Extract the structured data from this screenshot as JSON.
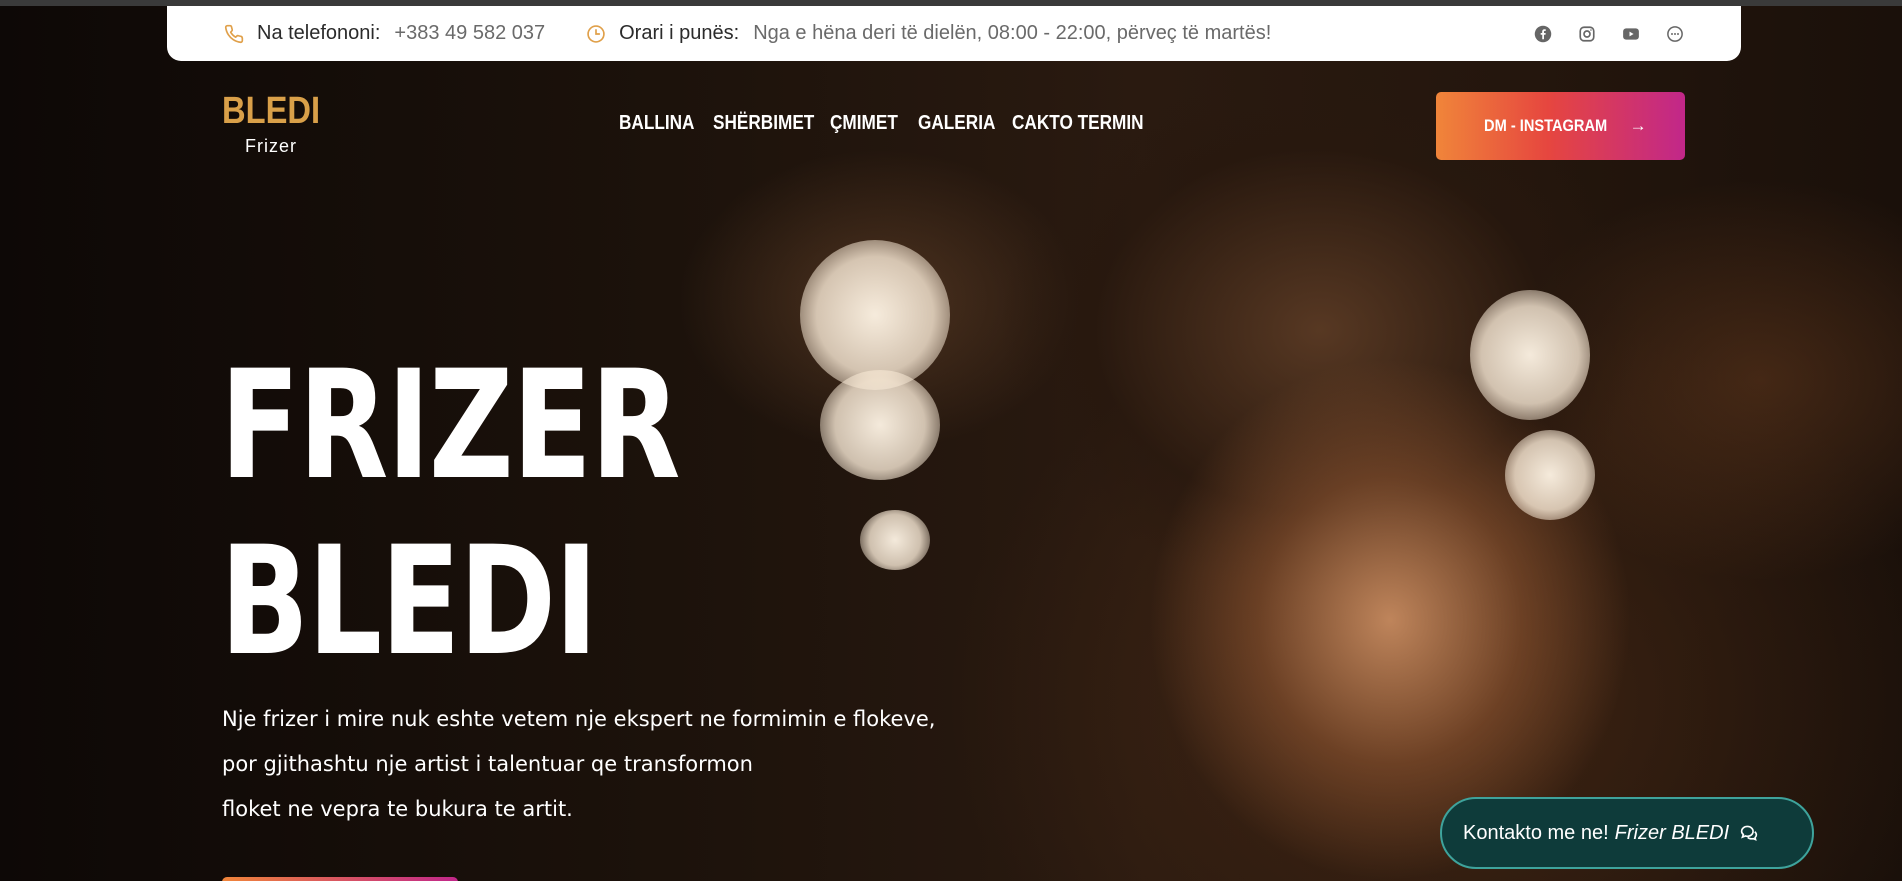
{
  "topbar": {
    "phone_label": "Na telefononi:",
    "phone_value": "+383 49 582 037",
    "hours_label": "Orari i punës:",
    "hours_value": "Nga e hëna deri të dielën, 08:00 - 22:00, përveç të martës!",
    "socials": [
      {
        "icon": "facebook-icon"
      },
      {
        "icon": "instagram-icon"
      },
      {
        "icon": "youtube-icon"
      },
      {
        "icon": "chat-icon"
      }
    ]
  },
  "logo": {
    "main": "BLEDI",
    "sub": "Frizer"
  },
  "nav": {
    "items": [
      "BALLINA",
      "SHËRBIMET",
      "ÇMIMET",
      "GALERIA",
      "CAKTO TERMIN"
    ]
  },
  "cta": {
    "label": "DM - INSTAGRAM",
    "arrow": "→"
  },
  "hero": {
    "title_line1": "FRIZER",
    "title_line2": "BLEDI",
    "desc_line1": "Nje frizer i mire nuk eshte vetem nje ekspert ne formimin e flokeve,",
    "desc_line2": "por gjithashtu nje artist i talentuar qe transformon",
    "desc_line3": "floket ne vepra te bukura te artit."
  },
  "contact_chip": {
    "text": "Kontakto me ne!",
    "brand": "Frizer BLEDI",
    "icon": "chat-bubbles-icon"
  },
  "colors": {
    "accent_gold": "#d9a049",
    "cta_gradient_start": "#f0853a",
    "cta_gradient_end": "#c1278a",
    "chip_bg": "#0e3b3a",
    "chip_border": "#3ea39c"
  }
}
